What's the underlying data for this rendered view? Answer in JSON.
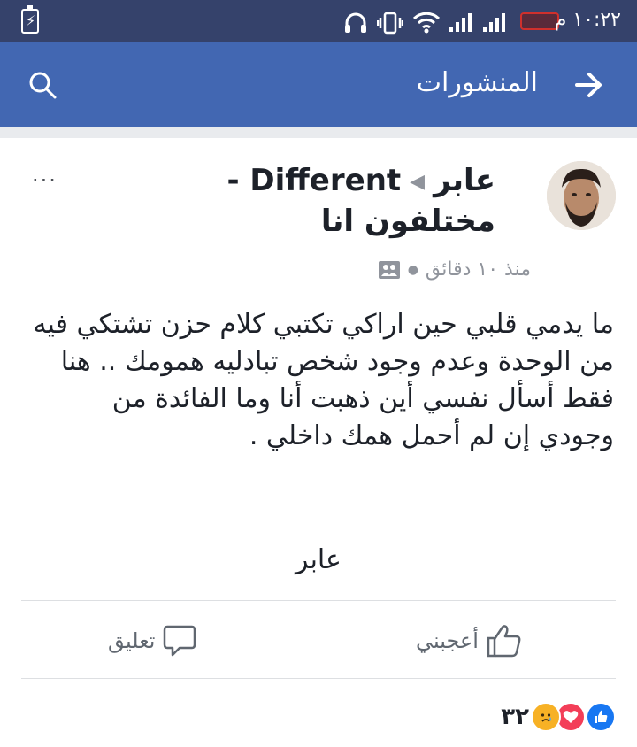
{
  "status_bar": {
    "time": "١٠:٢٢ م",
    "icons": [
      "battery-charging-icon",
      "headphones-icon",
      "vibrate-icon",
      "wifi-icon",
      "signal-icon",
      "signal-icon",
      "battery-low-icon"
    ]
  },
  "app_bar": {
    "title": "المنشورات",
    "back_icon": "arrow-right-icon",
    "search_icon": "search-icon",
    "color": "#4267b2"
  },
  "post": {
    "author": "عابر",
    "group": "Different - مختلفون انا",
    "time": "منذ ١٠ دقائق",
    "audience_icon": "group-audience-icon",
    "body": "ما يدمي قلبي حين اراكي تكتبي كلام حزن تشتكي فيه من الوحدة وعدم وجود شخص تبادليه همومك .. هنا فقط أسأل نفسي أين ذهبت أنا وما الفائدة من وجودي إن لم أحمل همك داخلي .",
    "signature": "عابر",
    "more_label": "···"
  },
  "actions": {
    "like": "أعجبني",
    "comment": "تعليق"
  },
  "reactions": {
    "count": "٣٢",
    "icons": [
      "like-reaction-icon",
      "love-reaction-icon",
      "sad-reaction-icon"
    ]
  }
}
